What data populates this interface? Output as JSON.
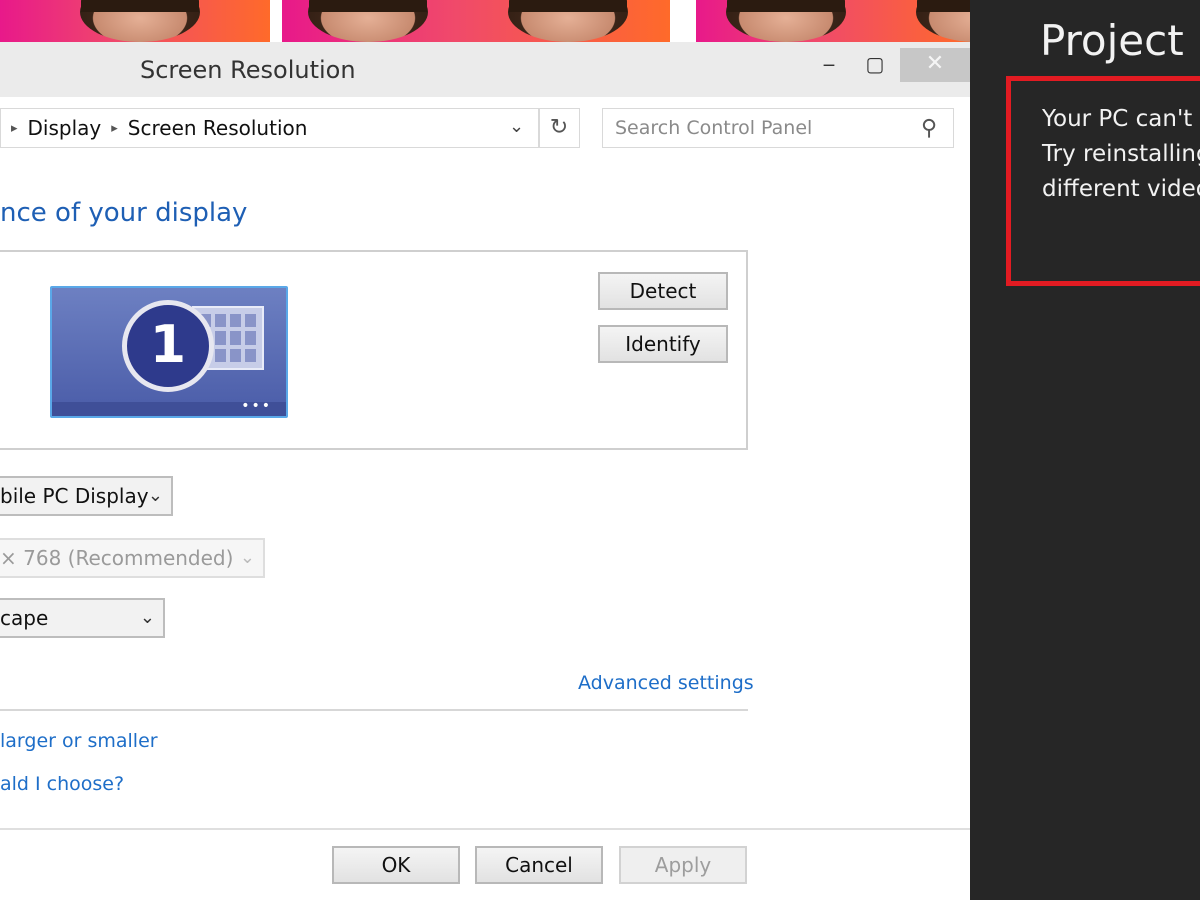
{
  "window": {
    "title": "Screen Resolution",
    "controls": {
      "minimize": "‒",
      "maximize": "▢",
      "close": "✕"
    }
  },
  "address": {
    "breadcrumbs": [
      "Display",
      "Screen Resolution"
    ],
    "separator": "▸",
    "dropdown_icon": "chevron-down-icon",
    "refresh_icon": "refresh-icon"
  },
  "search": {
    "placeholder": "Search Control Panel",
    "icon": "search-icon"
  },
  "content": {
    "heading": "nce of your display",
    "monitor_number": "1",
    "detect_label": "Detect",
    "identify_label": "Identify",
    "display_select": "bile PC Display",
    "resolution_select": "× 768 (Recommended)",
    "orientation_select": "cape",
    "advanced_link": "Advanced settings",
    "larger_link": "larger or smaller",
    "choose_link": "ald I choose?"
  },
  "footer": {
    "ok_label": "OK",
    "cancel_label": "Cancel",
    "apply_label": "Apply"
  },
  "project_panel": {
    "title": "Project",
    "lines": [
      "Your PC can't",
      "Try reinstalling",
      "different video"
    ],
    "accent_color": "#e21b22"
  }
}
